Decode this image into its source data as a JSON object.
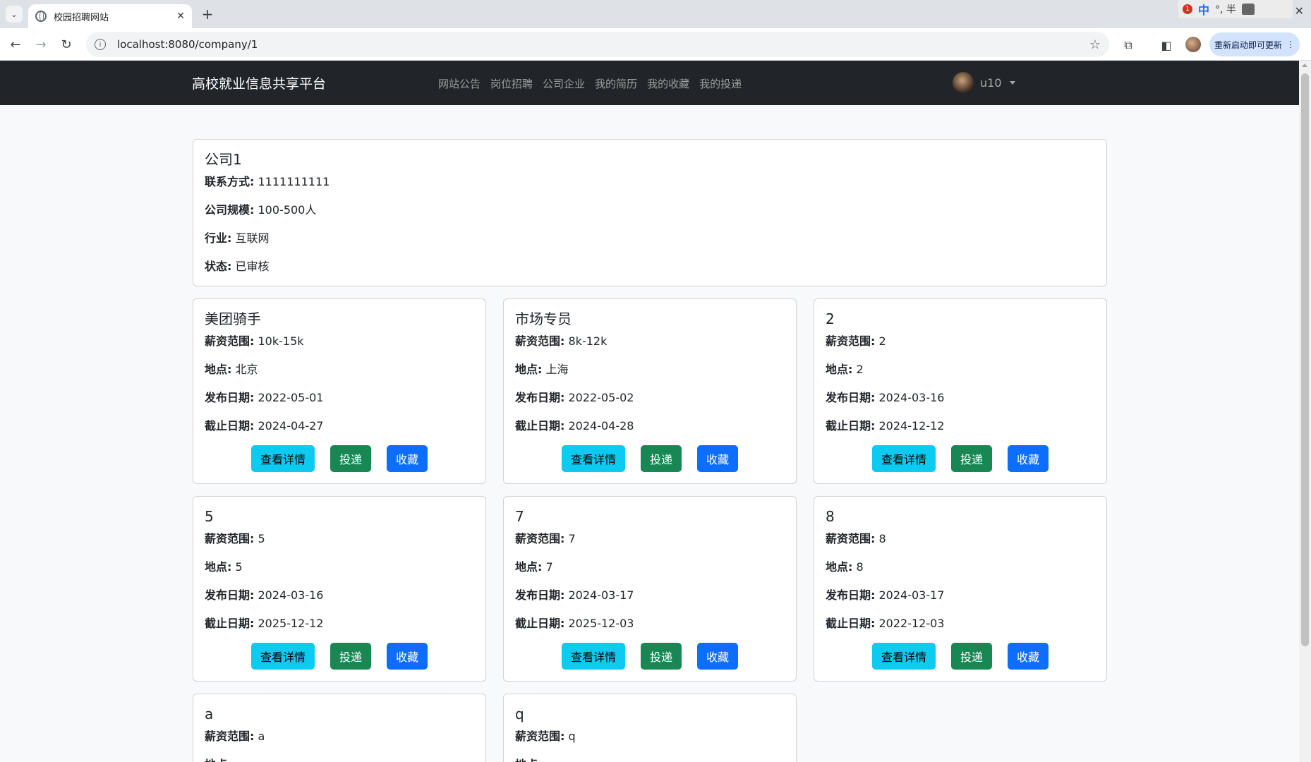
{
  "browser": {
    "tab_title": "校园招聘网站",
    "new_tab": "+",
    "url": "localhost:8080/company/1",
    "update_label": "重新启动即可更新",
    "tray": {
      "badge": "1",
      "ime": "中",
      "mode_text": "°, 半"
    }
  },
  "navbar": {
    "brand": "高校就业信息共享平台",
    "links": [
      "网站公告",
      "岗位招聘",
      "公司企业",
      "我的简历",
      "我的收藏",
      "我的投递"
    ],
    "username": "u10"
  },
  "labels": {
    "contact": "联系方式:",
    "scale": "公司规模:",
    "industry": "行业:",
    "status": "状态:",
    "salary": "薪资范围:",
    "location": "地点:",
    "publish": "发布日期:",
    "deadline": "截止日期:"
  },
  "buttons": {
    "detail": "查看详情",
    "apply": "投递",
    "favorite": "收藏"
  },
  "company": {
    "name": "公司1",
    "contact": "1111111111",
    "scale": "100-500人",
    "industry": "互联网",
    "status": "已审核"
  },
  "jobs": [
    {
      "title": "美团骑手",
      "salary": "10k-15k",
      "location": "北京",
      "publish": "2022-05-01",
      "deadline": "2024-04-27"
    },
    {
      "title": "市场专员",
      "salary": "8k-12k",
      "location": "上海",
      "publish": "2022-05-02",
      "deadline": "2024-04-28"
    },
    {
      "title": "2",
      "salary": "2",
      "location": "2",
      "publish": "2024-03-16",
      "deadline": "2024-12-12"
    },
    {
      "title": "5",
      "salary": "5",
      "location": "5",
      "publish": "2024-03-16",
      "deadline": "2025-12-12"
    },
    {
      "title": "7",
      "salary": "7",
      "location": "7",
      "publish": "2024-03-17",
      "deadline": "2025-12-03"
    },
    {
      "title": "8",
      "salary": "8",
      "location": "8",
      "publish": "2024-03-17",
      "deadline": "2022-12-03"
    },
    {
      "title": "a",
      "salary": "a",
      "location": "",
      "publish": "",
      "deadline": ""
    },
    {
      "title": "q",
      "salary": "q",
      "location": "",
      "publish": "",
      "deadline": ""
    }
  ]
}
